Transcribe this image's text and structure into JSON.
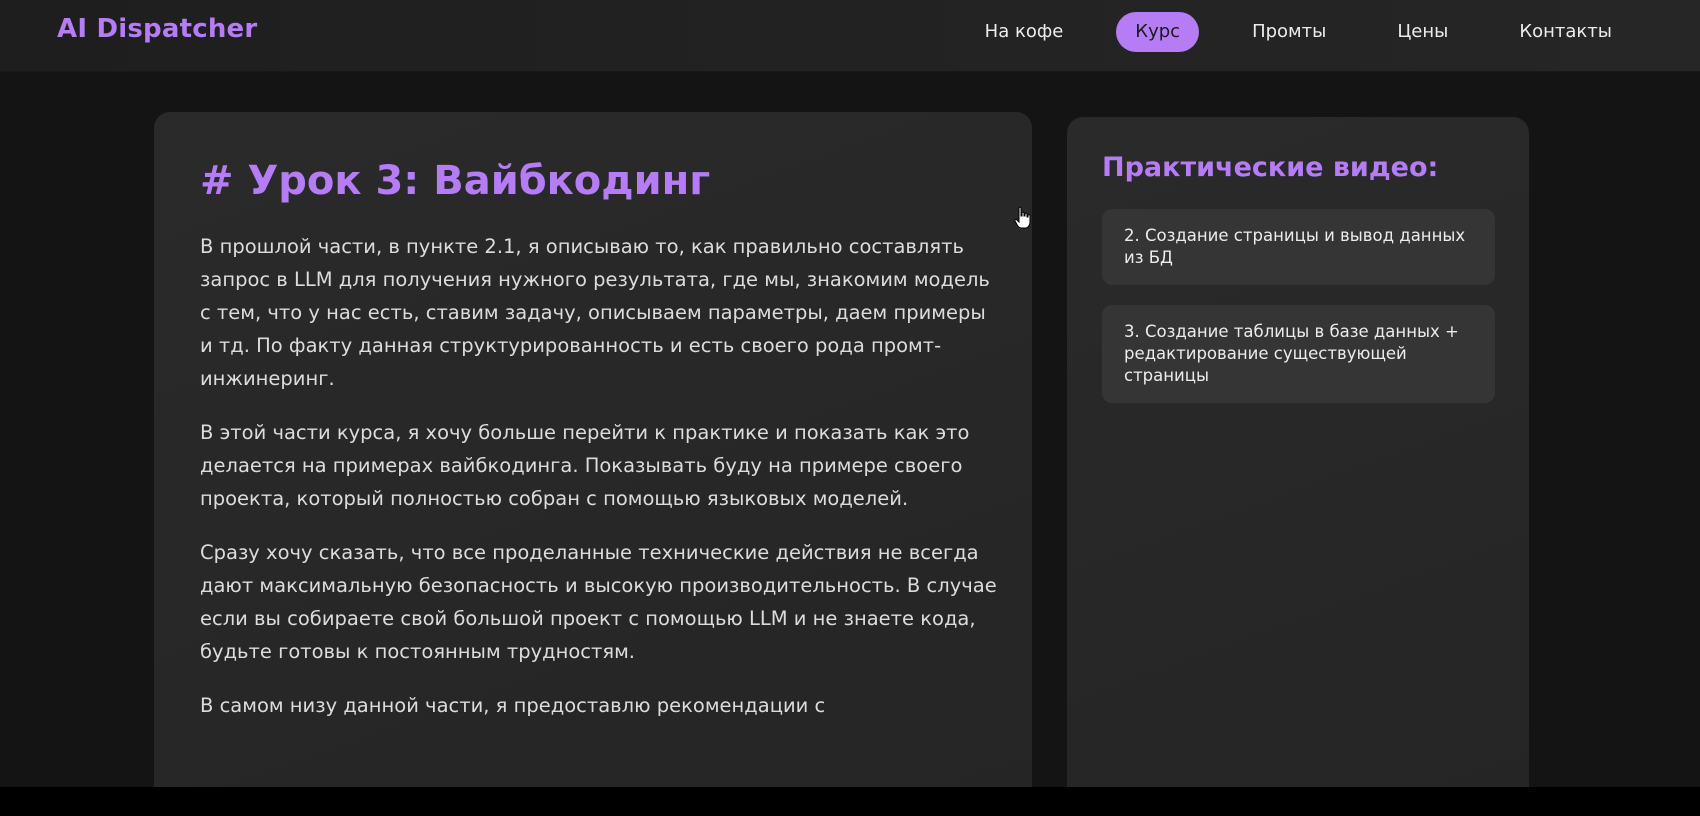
{
  "header": {
    "logo": "AI Dispatcher",
    "nav": [
      {
        "label": "На кофе",
        "active": false
      },
      {
        "label": "Курс",
        "active": true
      },
      {
        "label": "Промты",
        "active": false
      },
      {
        "label": "Цены",
        "active": false
      },
      {
        "label": "Контакты",
        "active": false
      }
    ]
  },
  "article": {
    "title": "# Урок 3: Вайбкодинг",
    "paragraphs": [
      "В прошлой части, в пункте 2.1, я описываю то, как правильно составлять запрос в LLM для получения нужного результата, где мы, знакомим модель с тем, что у нас есть, ставим задачу, описываем параметры, даем примеры и тд. По факту данная структурированность и есть своего рода промт-инжинеринг.",
      "В этой части курса, я хочу больше перейти к практике и показать как это делается на примерах вайбкодинга. Показывать буду на примере своего проекта, который полностью собран с помощью языковых моделей.",
      "Сразу хочу сказать, что все проделанные технические действия не всегда дают максимальную безопасность и высокую производительность. В случае если вы собираете свой большой проект с помощью LLM и не знаете кода, будьте готовы к постоянным трудностям.",
      "В самом низу данной части, я предоставлю рекомендации с"
    ]
  },
  "sidebar": {
    "title": "Практические видео:",
    "videos": [
      {
        "label": "2. Создание страницы и вывод данных из БД"
      },
      {
        "label": "3. Создание таблицы в базе данных + редактирование существующей страницы"
      }
    ]
  },
  "colors": {
    "accent": "#b57cf5",
    "background": "#141414",
    "card": "#2a2a2a",
    "video_item": "#353535",
    "text": "#dcdcdc"
  },
  "icons": {
    "cursor": "hand-pointer-icon"
  }
}
